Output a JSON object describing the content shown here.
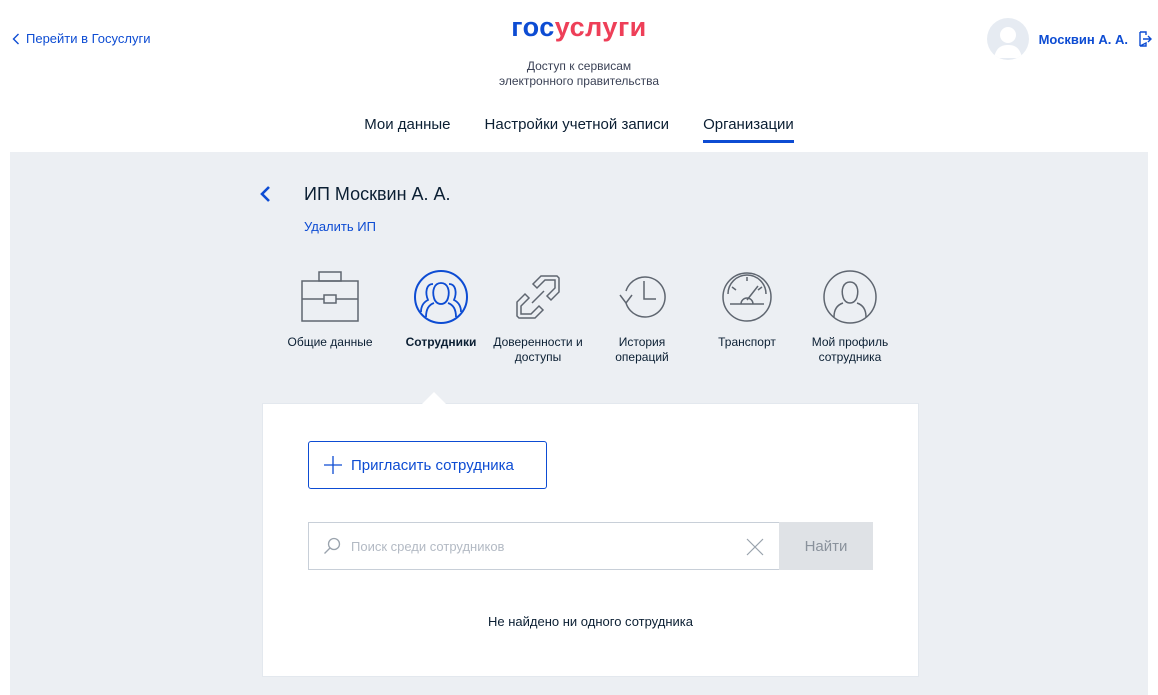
{
  "header": {
    "back_label": "Перейти в Госуслуги",
    "logo_part1": "гос",
    "logo_part2": "услуги",
    "tagline_line1": "Доступ к сервисам",
    "tagline_line2": "электронного правительства",
    "user_name": "Москвин А. А."
  },
  "tabs": [
    {
      "label": "Мои данные"
    },
    {
      "label": "Настройки учетной записи"
    },
    {
      "label": "Организации",
      "active": true
    }
  ],
  "org": {
    "title": "ИП Москвин А. А.",
    "delete_label": "Удалить ИП"
  },
  "menu": [
    {
      "line1": "Общие данные",
      "line2": "",
      "icon": "briefcase-icon"
    },
    {
      "line1": "Сотрудники",
      "line2": "",
      "icon": "employees-icon",
      "active": true
    },
    {
      "line1": "Доверенности и",
      "line2": "доступы",
      "icon": "link-icon"
    },
    {
      "line1": "История",
      "line2": "операций",
      "icon": "history-icon"
    },
    {
      "line1": "Транспорт",
      "line2": "",
      "icon": "speedometer-icon"
    },
    {
      "line1": "Мой профиль",
      "line2": "сотрудника",
      "icon": "profile-icon"
    }
  ],
  "employees": {
    "invite_label": "Пригласить сотрудника",
    "search_placeholder": "Поиск среди сотрудников",
    "search_value": "",
    "find_label": "Найти",
    "empty_text": "Не найдено ни одного сотрудника"
  },
  "colors": {
    "accent": "#0d4cd3",
    "logo_red": "#ee3f58",
    "background_gray": "#eceff3"
  }
}
